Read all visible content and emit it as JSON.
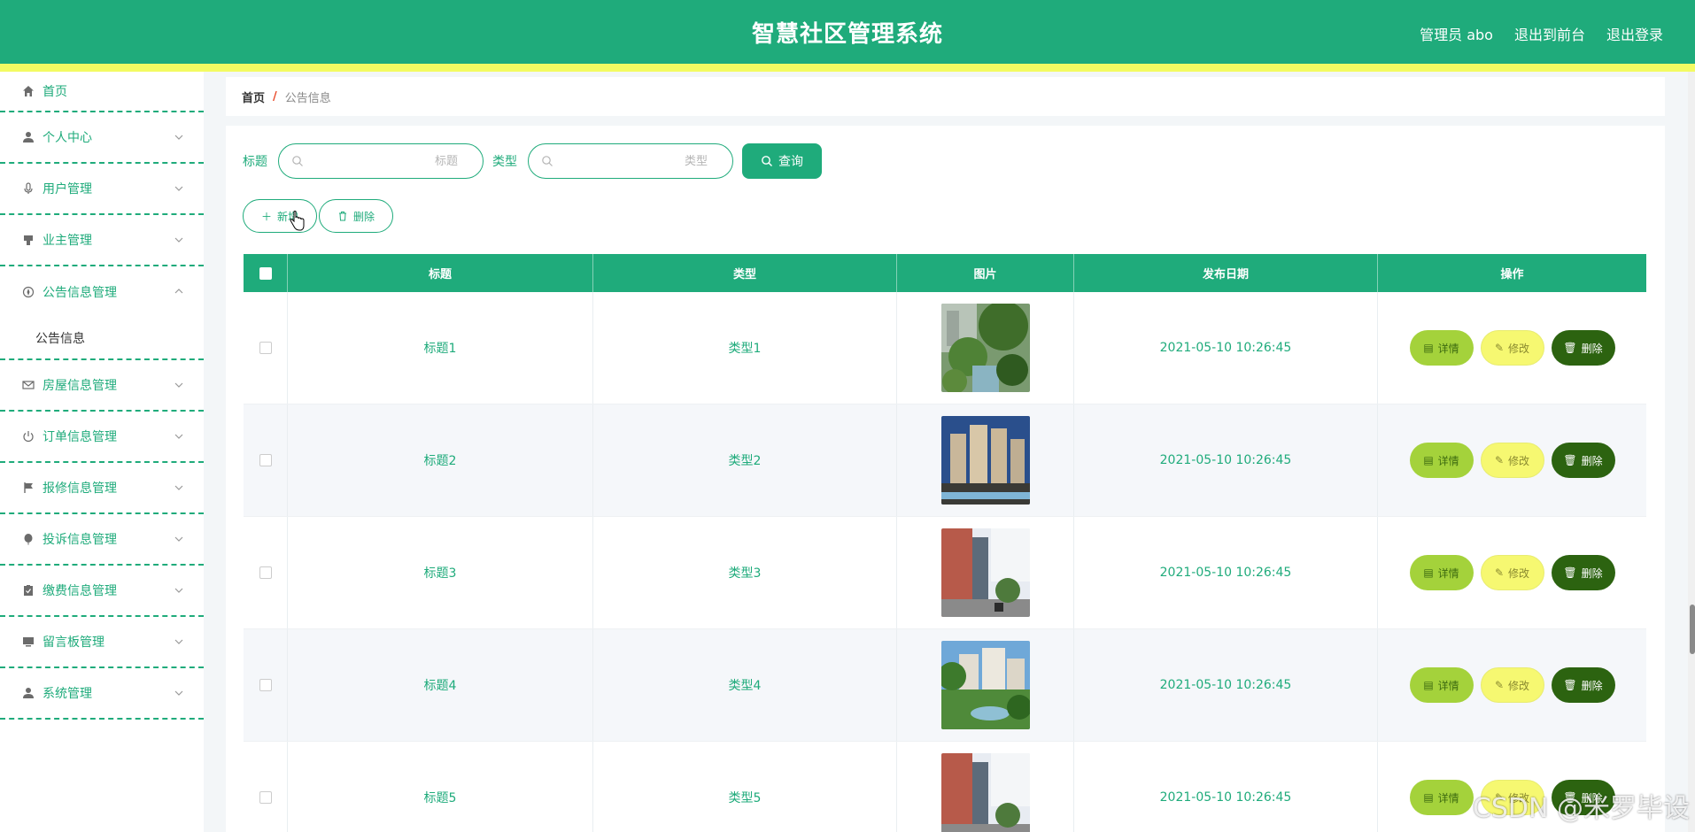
{
  "header": {
    "title": "智慧社区管理系统",
    "admin_label": "管理员 abo",
    "back_front": "退出到前台",
    "logout": "退出登录"
  },
  "sidebar": {
    "items": [
      {
        "label": "首页",
        "icon": "home-icon"
      },
      {
        "label": "个人中心",
        "icon": "user-icon"
      },
      {
        "label": "用户管理",
        "icon": "microphone-icon"
      },
      {
        "label": "业主管理",
        "icon": "stamp-icon"
      },
      {
        "label": "公告信息管理",
        "icon": "compass-icon",
        "open": true
      },
      {
        "label": "房屋信息管理",
        "icon": "mail-icon"
      },
      {
        "label": "订单信息管理",
        "icon": "power-icon"
      },
      {
        "label": "报修信息管理",
        "icon": "flag-icon"
      },
      {
        "label": "投诉信息管理",
        "icon": "balloon-icon"
      },
      {
        "label": "缴费信息管理",
        "icon": "clipboard-icon"
      },
      {
        "label": "留言板管理",
        "icon": "monitor-icon"
      },
      {
        "label": "系统管理",
        "icon": "user-icon"
      }
    ],
    "submenu_label": "公告信息"
  },
  "breadcrumb": {
    "home": "首页",
    "sep": "/",
    "current": "公告信息"
  },
  "search": {
    "title_label": "标题",
    "title_placeholder": "标题",
    "type_label": "类型",
    "type_placeholder": "类型",
    "query_label": "查询"
  },
  "actions": {
    "add_label": "新增",
    "delete_label": "删除"
  },
  "table": {
    "columns": [
      "标题",
      "类型",
      "图片",
      "发布日期",
      "操作"
    ],
    "rows": [
      {
        "title": "标题1",
        "type": "类型1",
        "date": "2021-05-10 10:26:45"
      },
      {
        "title": "标题2",
        "type": "类型2",
        "date": "2021-05-10 10:26:45"
      },
      {
        "title": "标题3",
        "type": "类型3",
        "date": "2021-05-10 10:26:45"
      },
      {
        "title": "标题4",
        "type": "类型4",
        "date": "2021-05-10 10:26:45"
      },
      {
        "title": "标题5",
        "type": "类型5",
        "date": "2021-05-10 10:26:45"
      }
    ],
    "op_detail": "详情",
    "op_edit": "修改",
    "op_delete": "删除"
  },
  "watermark": "CSDN @米罗毕设",
  "colors": {
    "primary": "#1fab7b",
    "stripe": "#f3fb62",
    "detail": "#a4d23b",
    "edit": "#f6f871",
    "delete": "#2c6310"
  }
}
